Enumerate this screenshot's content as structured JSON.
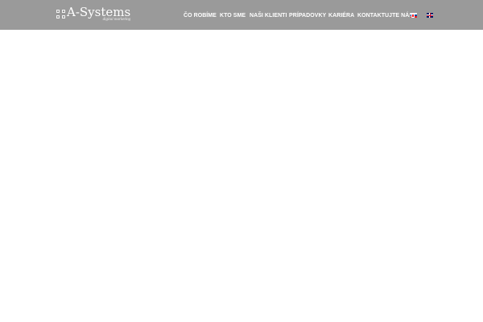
{
  "header": {
    "background_color": "#9a9a9a",
    "logo": {
      "name": "A-Systems",
      "tagline": "digital marketing",
      "icon": "grid-squares-logo-icon"
    },
    "nav": {
      "items": [
        {
          "id": "co-robime",
          "label": "ČO ROBÍME"
        },
        {
          "id": "kto-sme",
          "label": "KTO SME"
        },
        {
          "id": "nasi-klienti",
          "label": "NAŠI KLIENTI"
        },
        {
          "id": "pripadovky",
          "label": "PRÍPADOVKY"
        },
        {
          "id": "kariera",
          "label": "KARIÉRA"
        },
        {
          "id": "kontaktujte-nas",
          "label": "KONTAKTUJTE NÁS"
        }
      ],
      "languages": [
        {
          "code": "sk",
          "icon": "slovakia-flag-icon"
        },
        {
          "code": "en",
          "icon": "uk-flag-icon"
        }
      ]
    }
  },
  "main": {
    "background_color": "#ffffff"
  }
}
